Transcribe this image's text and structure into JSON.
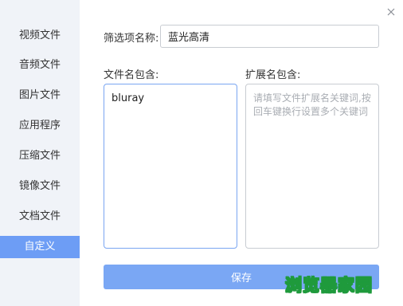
{
  "sidebar": {
    "items": [
      {
        "label": "视频文件",
        "active": false
      },
      {
        "label": "音频文件",
        "active": false
      },
      {
        "label": "图片文件",
        "active": false
      },
      {
        "label": "应用程序",
        "active": false
      },
      {
        "label": "压缩文件",
        "active": false
      },
      {
        "label": "镜像文件",
        "active": false
      },
      {
        "label": "文档文件",
        "active": false
      },
      {
        "label": "自定义",
        "active": true
      }
    ]
  },
  "form": {
    "filter_name_label": "筛选项名称:",
    "filter_name_value": "蓝光高清",
    "filename_label": "文件名包含:",
    "filename_value": "bluray",
    "extension_label": "扩展名包含:",
    "extension_placeholder": "请填写文件扩展名关键词,按回车键换行设置多个关键词",
    "save_label": "保存"
  },
  "icons": {
    "close": "close-icon"
  },
  "colors": {
    "accent": "#6d9df5",
    "sidebar_bg": "#f0f3f8",
    "save_button": "#7aa7f4",
    "focus_border": "#7aa6f2"
  },
  "watermark": {
    "text": "浏览器家园"
  }
}
